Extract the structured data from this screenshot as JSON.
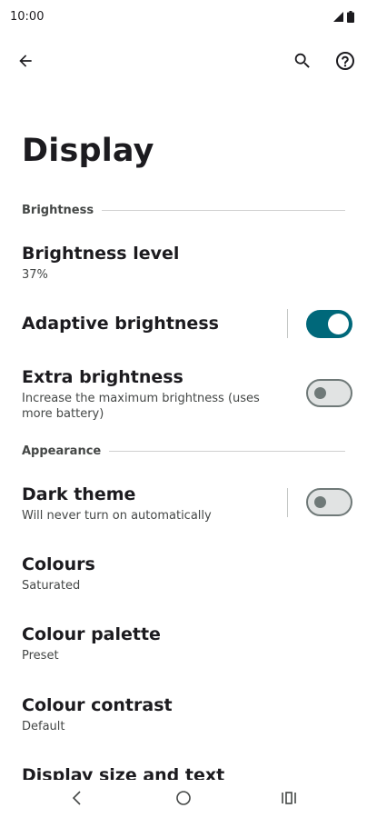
{
  "status_bar": {
    "time": "10:00",
    "icons": [
      "signal-icon",
      "battery-icon"
    ]
  },
  "toolbar": {
    "icons": [
      "back-arrow-icon",
      "search-icon",
      "help-icon"
    ]
  },
  "page": {
    "title": "Display"
  },
  "sections": {
    "brightness": {
      "header": "Brightness",
      "brightness_level": {
        "title": "Brightness level",
        "value": "37%"
      },
      "adaptive_brightness": {
        "title": "Adaptive brightness",
        "enabled": true
      },
      "extra_brightness": {
        "title": "Extra brightness",
        "subtitle": "Increase the maximum brightness (uses more battery)",
        "enabled": false
      }
    },
    "appearance": {
      "header": "Appearance",
      "dark_theme": {
        "title": "Dark theme",
        "subtitle": "Will never turn on automatically",
        "enabled": false
      },
      "colours": {
        "title": "Colours",
        "subtitle": "Saturated"
      },
      "colour_palette": {
        "title": "Colour palette",
        "subtitle": "Preset"
      },
      "colour_contrast": {
        "title": "Colour contrast",
        "subtitle": "Default"
      },
      "display_size": {
        "title": "Display size and text"
      }
    }
  },
  "nav_bar": {
    "icons": [
      "nav-back-icon",
      "nav-home-icon",
      "nav-recents-icon"
    ]
  },
  "colors": {
    "accent": "#00687a",
    "switch_off_track": "#e1e3e3",
    "switch_off_outline": "#6f7978",
    "text_primary": "#1c1b1f",
    "text_secondary": "#444746"
  }
}
